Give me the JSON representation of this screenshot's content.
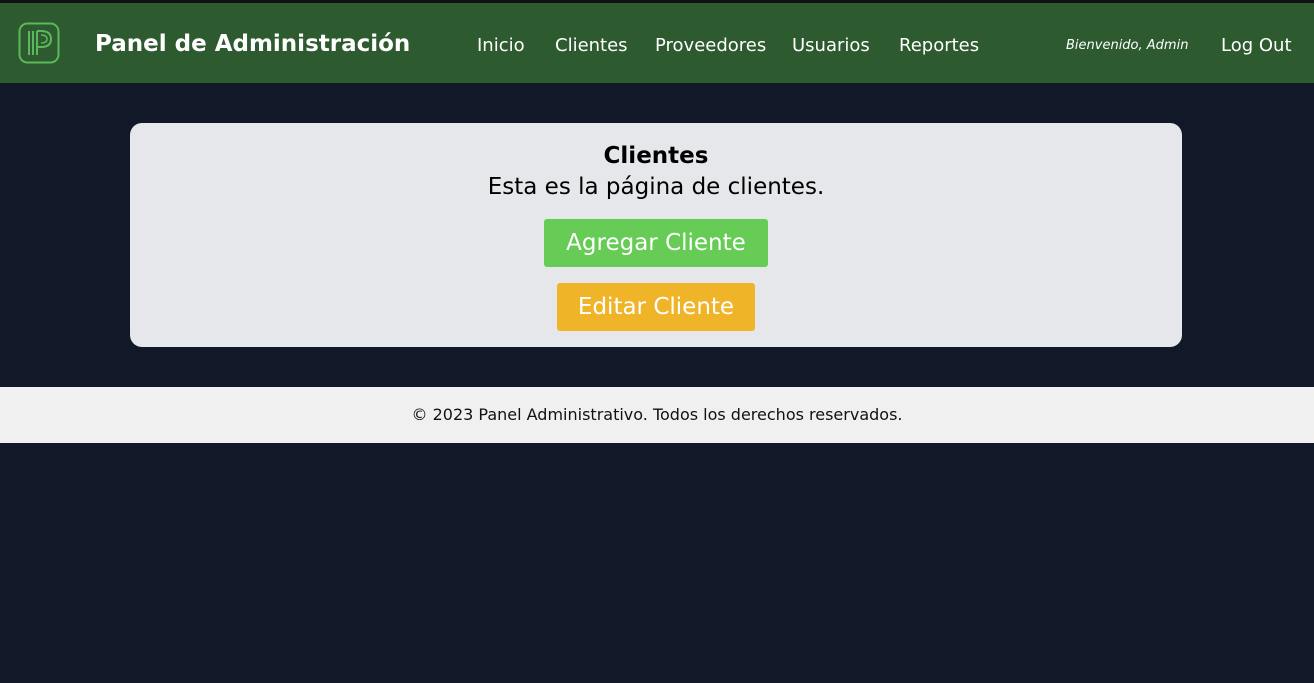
{
  "header": {
    "brand_title": "Panel de Administración",
    "logo_icon": "p-logo-icon",
    "nav": [
      {
        "label": "Inicio"
      },
      {
        "label": "Clientes"
      },
      {
        "label": "Proveedores"
      },
      {
        "label": "Usuarios"
      },
      {
        "label": "Reportes"
      }
    ],
    "welcome_text": "Bienvenido, Admin",
    "logout_label": "Log Out"
  },
  "main": {
    "title": "Clientes",
    "subtitle": "Esta es la página de clientes.",
    "add_button_label": "Agregar Cliente",
    "edit_button_label": "Editar Cliente"
  },
  "footer": {
    "text": "© 2023 Panel Administrativo. Todos los derechos reservados."
  },
  "colors": {
    "header_bg": "#2d5a2e",
    "page_bg": "#111827",
    "card_bg": "#e5e7eb",
    "add_button": "#66cc55",
    "edit_button": "#f0b429",
    "footer_bg": "#f0f0f0",
    "logo_accent": "#5cb85c"
  }
}
